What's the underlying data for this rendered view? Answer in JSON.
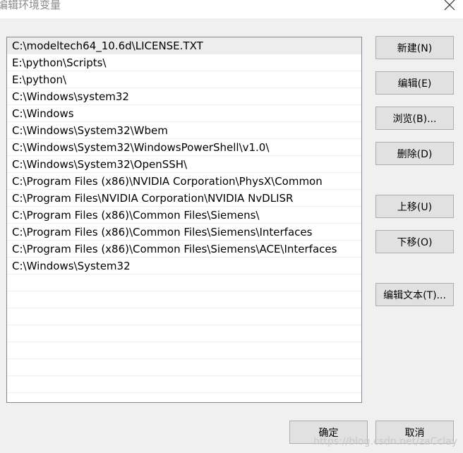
{
  "window": {
    "title": "编辑环境变量"
  },
  "paths": [
    "C:\\modeltech64_10.6d\\LICENSE.TXT",
    "E:\\python\\Scripts\\",
    "E:\\python\\",
    "C:\\Windows\\system32",
    "C:\\Windows",
    "C:\\Windows\\System32\\Wbem",
    "C:\\Windows\\System32\\WindowsPowerShell\\v1.0\\",
    "C:\\Windows\\System32\\OpenSSH\\",
    "C:\\Program Files (x86)\\NVIDIA Corporation\\PhysX\\Common",
    "C:\\Program Files\\NVIDIA Corporation\\NVIDIA NvDLISR",
    "C:\\Program Files (x86)\\Common Files\\Siemens\\",
    "C:\\Program Files (x86)\\Common Files\\Siemens\\Interfaces",
    "C:\\Program Files (x86)\\Common Files\\Siemens\\ACE\\Interfaces",
    "C:\\Windows\\System32"
  ],
  "buttons": {
    "new": "新建(N)",
    "edit": "编辑(E)",
    "browse": "浏览(B)...",
    "delete": "删除(D)",
    "move_up": "上移(U)",
    "move_down": "下移(O)",
    "edit_text": "编辑文本(T)...",
    "ok": "确定",
    "cancel": "取消"
  },
  "watermark": "https://blog.csdn.net/zaCclay",
  "colors": {
    "button_bg": "#e1e1e1",
    "button_border": "#adadad",
    "selection": "#ededed"
  }
}
